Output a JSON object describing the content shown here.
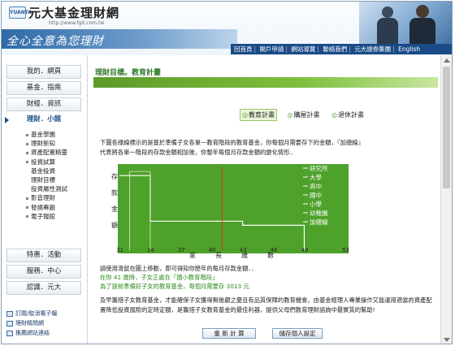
{
  "header": {
    "logo_text": "元大基金理財網",
    "logo_mark": "YUANTA",
    "url": "http://www.fgit.com.tw",
    "slogan": "全心全意為您理財",
    "nav": [
      "回首頁",
      "開戶申請",
      "網站導覽",
      "聯絡我們",
      "元大證券集團",
      "English"
    ]
  },
  "sidebar": {
    "items": [
      {
        "label": "我的．網頁"
      },
      {
        "label": "基金．指南"
      },
      {
        "label": "財經．資訊"
      },
      {
        "label": "理財．小館"
      },
      {
        "label": "特惠．活動"
      },
      {
        "label": "服務．中心"
      },
      {
        "label": "認識．元大"
      }
    ],
    "submenu": [
      "基金學園",
      "理財新知",
      "資產配置精靈",
      "投資試算",
      "基金投資",
      "理財目標",
      "投資屬性測試",
      "影音理財",
      "發燒專題",
      "電子報館"
    ],
    "bottom_links": [
      "訂閱/取消電子報",
      "理財精問網",
      "推薦網站連結"
    ]
  },
  "main": {
    "title": "理財目標。教育計畫",
    "tabs": [
      "教育計畫",
      "購屋計畫",
      "退休計畫"
    ],
    "desc": "下圖各綠線標示的是基於準備子女各單一教育階段的教育基金，你每個月需要存下的金額，『加總線』代表將各單一階段的存款金額相加後，你整年每個月存款金額的變化情形..",
    "ylabel": [
      "存",
      "款",
      "金",
      "額"
    ],
    "xlabel": [
      "家",
      "長",
      "歲",
      "數"
    ],
    "legend": [
      "研究所",
      "大學",
      "高中",
      "國中",
      "小學",
      "幼稚園",
      "加總線"
    ],
    "info1": "請使用滑鼠在圖上移動，即可得知你歷年的每月存款金額．．",
    "info2": "在你 41 歲時，子女正處在「國小教育階段」",
    "info3": "為了提前準備好子女的教育基金，每個月需要存 3013 元",
    "para": "及早籌措子女教育基金，才能確保子女獲得無後顧之憂且有品質保障的教育機會。由基金經理人專業操作又能運用適當的資產配置降低投資風險的定時定額，是籌措子女教育基金的最佳利器，提供父母們教育理財諮詢中最實質的幫助!",
    "buttons": [
      "重 新 計 算",
      "儲存個人設定"
    ]
  },
  "chart_data": {
    "type": "line",
    "xlabel": "家長歲數",
    "ylabel": "存款金額",
    "x_ticks": [
      31,
      34,
      37,
      40,
      43,
      46,
      49,
      53
    ],
    "xlim": [
      31,
      53
    ],
    "marker_x": 41,
    "series": [
      {
        "name": "加總線",
        "points": [
          [
            31,
            0.9
          ],
          [
            34,
            0.9
          ],
          [
            34,
            0.35
          ],
          [
            43,
            0.35
          ],
          [
            43,
            0.3
          ],
          [
            49,
            0.3
          ],
          [
            49,
            0.0
          ]
        ]
      },
      {
        "name": "幼稚園",
        "points": [
          [
            32,
            0.0
          ],
          [
            32,
            0.95
          ],
          [
            34,
            0.95
          ],
          [
            34,
            0.0
          ]
        ]
      }
    ],
    "colors": {
      "background": "#4ea12a",
      "line": "#ffffff",
      "marker": "#e03030"
    }
  }
}
